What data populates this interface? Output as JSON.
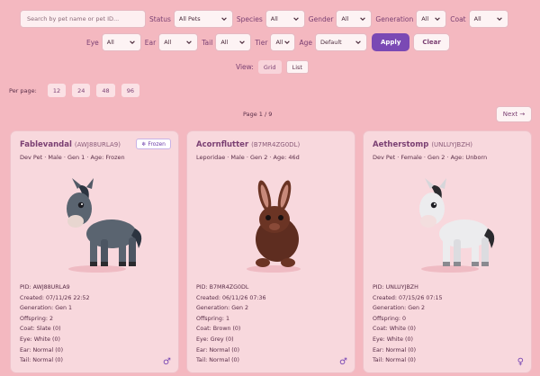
{
  "filters": {
    "search_placeholder": "Search by pet name or pet ID...",
    "status": {
      "label": "Status",
      "value": "All Pets"
    },
    "species": {
      "label": "Species",
      "value": "All"
    },
    "gender": {
      "label": "Gender",
      "value": "All"
    },
    "generation": {
      "label": "Generation",
      "value": "All"
    },
    "coat": {
      "label": "Coat",
      "value": "All"
    },
    "eye": {
      "label": "Eye",
      "value": "All"
    },
    "ear": {
      "label": "Ear",
      "value": "All"
    },
    "tail": {
      "label": "Tail",
      "value": "All"
    },
    "tier": {
      "label": "Tier",
      "value": "All"
    },
    "age": {
      "label": "Age",
      "value": "Default"
    },
    "apply_label": "Apply",
    "clear_label": "Clear"
  },
  "view": {
    "label": "View:",
    "options": [
      "Grid",
      "List"
    ],
    "active": "List"
  },
  "per_page": {
    "label": "Per page:",
    "options": [
      "12",
      "24",
      "48",
      "96"
    ]
  },
  "pagination": {
    "page_text": "Page 1 / 9",
    "next_label": "Next →"
  },
  "pets": [
    {
      "name": "Fablevandal",
      "code": "(AWJ88URLA9)",
      "subtitle": "Dev Pet · Male · Gen 1 · Age: Frozen",
      "badge": "❄ Frozen",
      "pid": "PID: AWJ88URLA9",
      "created": "Created: 07/11/26 22:52",
      "generation": "Generation: Gen 1",
      "offspring": "Offspring: 2",
      "coat": "Coat: Slate (0)",
      "eye": "Eye: White (0)",
      "ear": "Ear: Normal (0)",
      "tail": "Tail: Normal (0)",
      "gender_symbol": "♂"
    },
    {
      "name": "Acornflutter",
      "code": "(B7MR4ZG0DL)",
      "subtitle": "Leporidae · Male · Gen 2 · Age: 46d",
      "badge": "",
      "pid": "PID: B7MR4ZG0DL",
      "created": "Created: 06/11/26 07:36",
      "generation": "Generation: Gen 2",
      "offspring": "Offspring: 1",
      "coat": "Coat: Brown (0)",
      "eye": "Eye: Grey (0)",
      "ear": "Ear: Normal (0)",
      "tail": "Tail: Normal (0)",
      "gender_symbol": "♂"
    },
    {
      "name": "Aetherstomp",
      "code": "(UNLUYJBZH)",
      "subtitle": "Dev Pet · Female · Gen 2 · Age: Unborn",
      "badge": "",
      "pid": "PID: UNLUYJBZH",
      "created": "Created: 07/15/26 07:15",
      "generation": "Generation: Gen 2",
      "offspring": "Offspring: 0",
      "coat": "Coat: White (0)",
      "eye": "Eye: White (0)",
      "ear": "Ear: Normal (0)",
      "tail": "Tail: Normal (0)",
      "gender_symbol": "♀"
    }
  ],
  "colors": {
    "background": "#f4b8c0",
    "accent": "#7a49b4",
    "card": "#f8d8dd",
    "title": "#7a3f72"
  }
}
